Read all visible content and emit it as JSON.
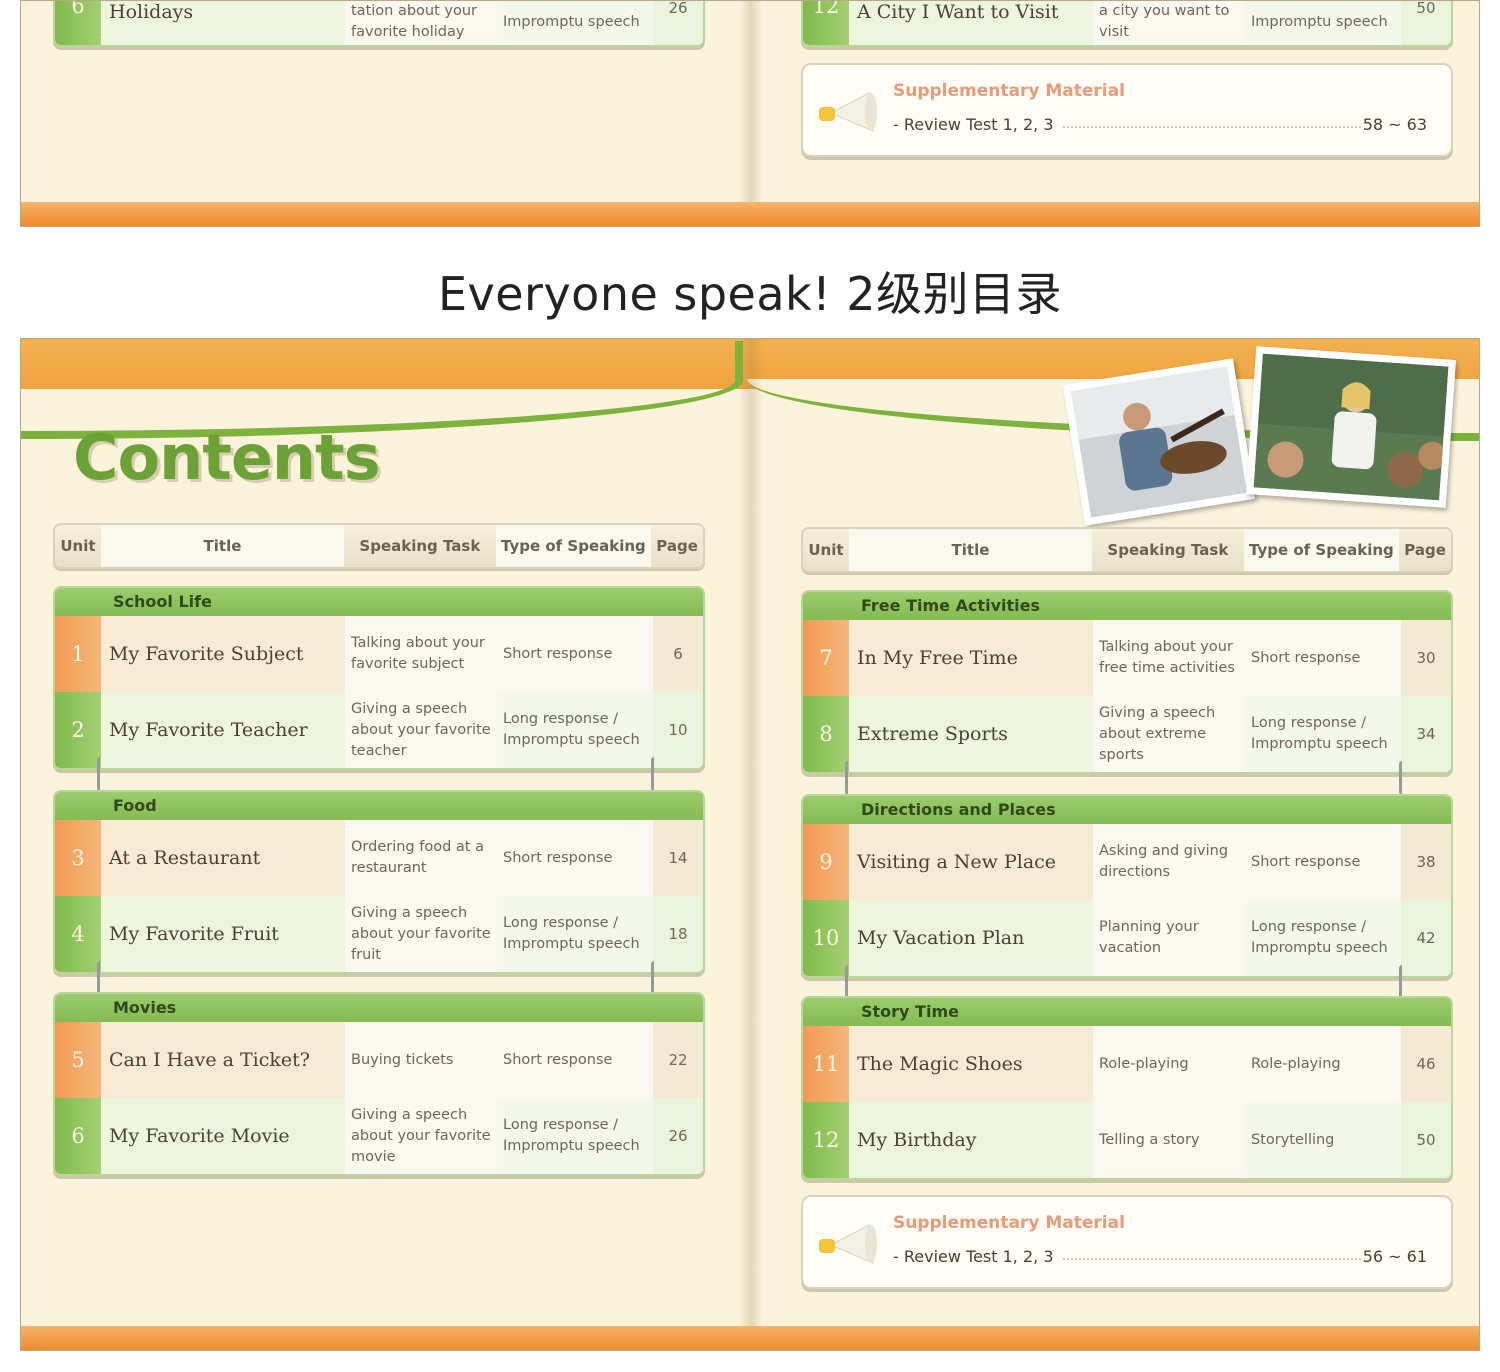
{
  "caption": "Everyone speak! 2级别目录",
  "top_page": {
    "left_row": {
      "num": "6",
      "title": "Holidays",
      "task": "tation about your favorite holiday",
      "type": "Impromptu speech",
      "page": "26"
    },
    "right_row": {
      "num": "12",
      "title": "A City I Want to Visit",
      "task": "a city you want to visit",
      "type": "Impromptu speech",
      "page": "50"
    },
    "supplementary": {
      "title": "Supplementary Material",
      "line": "- Review Test 1, 2, 3",
      "pages": "58 ~ 63"
    }
  },
  "contents_title": "Contents",
  "headers": {
    "unit": "Unit",
    "title": "Title",
    "task": "Speaking Task",
    "type": "Type of Speaking",
    "page": "Page"
  },
  "left_sections": [
    {
      "name": "School Life",
      "rows": [
        {
          "num": "1",
          "title": "My Favorite Subject",
          "task": "Talking about your favorite subject",
          "type": "Short response",
          "page": "6"
        },
        {
          "num": "2",
          "title": "My Favorite Teacher",
          "task": "Giving a speech about your favorite teacher",
          "type": "Long response / Impromptu speech",
          "page": "10"
        }
      ]
    },
    {
      "name": "Food",
      "rows": [
        {
          "num": "3",
          "title": "At a Restaurant",
          "task": "Ordering food at a restaurant",
          "type": "Short response",
          "page": "14"
        },
        {
          "num": "4",
          "title": "My Favorite Fruit",
          "task": "Giving a speech about your favorite fruit",
          "type": "Long response / Impromptu speech",
          "page": "18"
        }
      ]
    },
    {
      "name": "Movies",
      "rows": [
        {
          "num": "5",
          "title": "Can I Have a Ticket?",
          "task": "Buying tickets",
          "type": "Short response",
          "page": "22"
        },
        {
          "num": "6",
          "title": "My Favorite Movie",
          "task": "Giving a speech about your favorite movie",
          "type": "Long response / Impromptu speech",
          "page": "26"
        }
      ]
    }
  ],
  "right_sections": [
    {
      "name": "Free Time Activities",
      "rows": [
        {
          "num": "7",
          "title": "In My Free Time",
          "task": "Talking about your free time activities",
          "type": "Short response",
          "page": "30"
        },
        {
          "num": "8",
          "title": "Extreme Sports",
          "task": "Giving a speech about extreme sports",
          "type": "Long response / Impromptu speech",
          "page": "34"
        }
      ]
    },
    {
      "name": "Directions and Places",
      "rows": [
        {
          "num": "9",
          "title": "Visiting a New Place",
          "task": "Asking and giving directions",
          "type": "Short response",
          "page": "38"
        },
        {
          "num": "10",
          "title": "My Vacation Plan",
          "task": "Planning your vacation",
          "type": "Long response / Impromptu speech",
          "page": "42"
        }
      ]
    },
    {
      "name": "Story Time",
      "rows": [
        {
          "num": "11",
          "title": "The Magic Shoes",
          "task": "Role-playing",
          "type": "Role-playing",
          "page": "46"
        },
        {
          "num": "12",
          "title": "My Birthday",
          "task": "Telling a story",
          "type": "Storytelling",
          "page": "50"
        }
      ]
    }
  ],
  "supplementary": {
    "title": "Supplementary Material",
    "line": "- Review Test 1, 2, 3",
    "pages": "56 ~ 61"
  },
  "colors": {
    "green": "#7db33c",
    "orange": "#ee8a2c",
    "paper": "#fcf3dc",
    "salmon": "#e79b7a"
  },
  "icons": [
    "megaphone-icon",
    "binder-ring-icon"
  ]
}
